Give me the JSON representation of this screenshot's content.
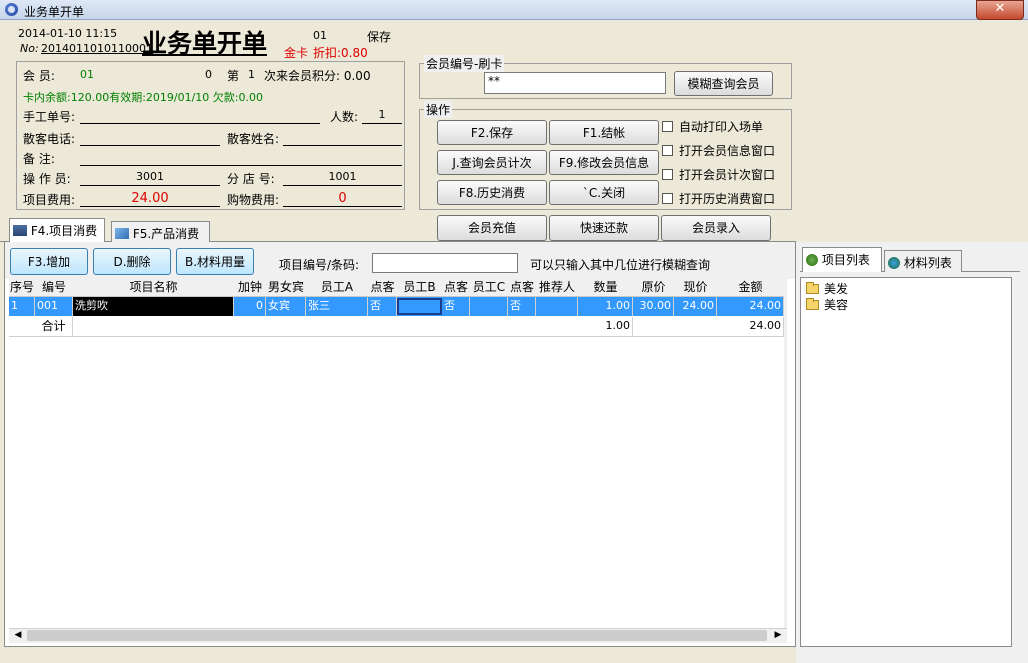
{
  "window": {
    "title": "业务单开单",
    "close_label": "✕"
  },
  "header": {
    "datetime": "2014-01-10 11:15",
    "code": "01",
    "save_text": "保存",
    "no_label": "No:",
    "order_no": "2014011010110001",
    "big_title": "业务单开单",
    "card_type": "金卡",
    "discount": "折扣:0.80"
  },
  "member": {
    "label": "会    员:",
    "id": "01",
    "count": "0",
    "di_label": "第",
    "di_value": "1",
    "points_text": "次来会员积分: 0.00",
    "balance_text": "卡内余额:120.00有效期:2019/01/10 欠款:0.00"
  },
  "form": {
    "manual_no_label": "手工单号:",
    "people_label": "人数:",
    "people_value": "1",
    "guest_phone_label": "散客电话:",
    "guest_name_label": "散客姓名:",
    "remark_label": "备    注:",
    "operator_label": "操 作 员:",
    "operator_value": "3001",
    "branch_label": "分 店 号:",
    "branch_value": "1001",
    "item_fee_label": "项目费用:",
    "item_fee_value": "24.00",
    "shop_fee_label": "购物费用:",
    "shop_fee_value": "0"
  },
  "card_group": {
    "legend": "会员编号-刷卡",
    "input_value": "**",
    "search_button": "模糊查询会员"
  },
  "ops": {
    "legend": "操作",
    "save": "F2.保存",
    "checkout": "F1.结帐",
    "query_count": "J.查询会员计次",
    "edit_member": "F9.修改会员信息",
    "history": "F8.历史消费",
    "close": "`C.关闭",
    "chk_print": "自动打印入场单",
    "chk_info": "打开会员信息窗口",
    "chk_count": "打开会员计次窗口",
    "chk_history": "打开历史消费窗口",
    "recharge": "会员充值",
    "repay": "快速还款",
    "add_member": "会员录入"
  },
  "tabs": {
    "items_tab": "F4.项目消费",
    "products_tab": "F5.产品消费"
  },
  "toolbar": {
    "add": "F3.增加",
    "delete": "D.删除",
    "material": "B.材料用量",
    "code_label": "项目编号/条码:",
    "hint": "可以只输入其中几位进行模糊查询"
  },
  "grid": {
    "headers": [
      "序号",
      "编号",
      "项目名称",
      "加钟",
      "男女宾",
      "员工A",
      "点客",
      "员工B",
      "点客",
      "员工C",
      "点客",
      "推荐人",
      "数量",
      "原价",
      "现价",
      "金额"
    ],
    "row": {
      "seq": "1",
      "code": "001",
      "name": "洗剪吹",
      "extra": "0",
      "gender": "女宾",
      "staff_a": "张三",
      "pick_a": "否",
      "staff_b": "",
      "pick_b": "否",
      "staff_c": "",
      "pick_c": "否",
      "referrer": "",
      "qty": "1.00",
      "orig_price": "30.00",
      "price": "24.00",
      "amount": "24.00"
    },
    "total": {
      "label": "合计",
      "qty": "1.00",
      "amount": "24.00"
    }
  },
  "right_panel": {
    "tab_items": "项目列表",
    "tab_materials": "材料列表",
    "tree": [
      "美发",
      "美容"
    ]
  }
}
